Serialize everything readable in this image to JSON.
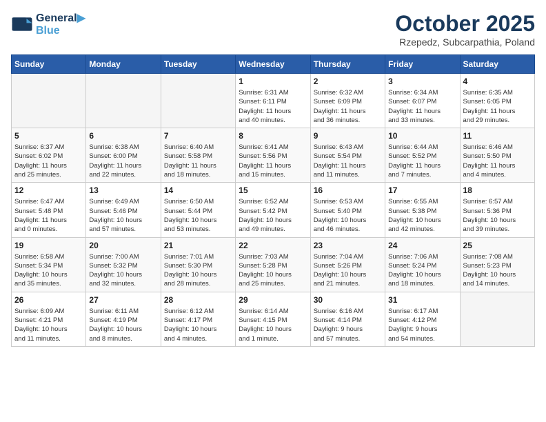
{
  "header": {
    "logo_line1": "General",
    "logo_line2": "Blue",
    "month": "October 2025",
    "location": "Rzepedz, Subcarpathia, Poland"
  },
  "weekdays": [
    "Sunday",
    "Monday",
    "Tuesday",
    "Wednesday",
    "Thursday",
    "Friday",
    "Saturday"
  ],
  "weeks": [
    [
      {
        "day": "",
        "info": ""
      },
      {
        "day": "",
        "info": ""
      },
      {
        "day": "",
        "info": ""
      },
      {
        "day": "1",
        "info": "Sunrise: 6:31 AM\nSunset: 6:11 PM\nDaylight: 11 hours\nand 40 minutes."
      },
      {
        "day": "2",
        "info": "Sunrise: 6:32 AM\nSunset: 6:09 PM\nDaylight: 11 hours\nand 36 minutes."
      },
      {
        "day": "3",
        "info": "Sunrise: 6:34 AM\nSunset: 6:07 PM\nDaylight: 11 hours\nand 33 minutes."
      },
      {
        "day": "4",
        "info": "Sunrise: 6:35 AM\nSunset: 6:05 PM\nDaylight: 11 hours\nand 29 minutes."
      }
    ],
    [
      {
        "day": "5",
        "info": "Sunrise: 6:37 AM\nSunset: 6:02 PM\nDaylight: 11 hours\nand 25 minutes."
      },
      {
        "day": "6",
        "info": "Sunrise: 6:38 AM\nSunset: 6:00 PM\nDaylight: 11 hours\nand 22 minutes."
      },
      {
        "day": "7",
        "info": "Sunrise: 6:40 AM\nSunset: 5:58 PM\nDaylight: 11 hours\nand 18 minutes."
      },
      {
        "day": "8",
        "info": "Sunrise: 6:41 AM\nSunset: 5:56 PM\nDaylight: 11 hours\nand 15 minutes."
      },
      {
        "day": "9",
        "info": "Sunrise: 6:43 AM\nSunset: 5:54 PM\nDaylight: 11 hours\nand 11 minutes."
      },
      {
        "day": "10",
        "info": "Sunrise: 6:44 AM\nSunset: 5:52 PM\nDaylight: 11 hours\nand 7 minutes."
      },
      {
        "day": "11",
        "info": "Sunrise: 6:46 AM\nSunset: 5:50 PM\nDaylight: 11 hours\nand 4 minutes."
      }
    ],
    [
      {
        "day": "12",
        "info": "Sunrise: 6:47 AM\nSunset: 5:48 PM\nDaylight: 11 hours\nand 0 minutes."
      },
      {
        "day": "13",
        "info": "Sunrise: 6:49 AM\nSunset: 5:46 PM\nDaylight: 10 hours\nand 57 minutes."
      },
      {
        "day": "14",
        "info": "Sunrise: 6:50 AM\nSunset: 5:44 PM\nDaylight: 10 hours\nand 53 minutes."
      },
      {
        "day": "15",
        "info": "Sunrise: 6:52 AM\nSunset: 5:42 PM\nDaylight: 10 hours\nand 49 minutes."
      },
      {
        "day": "16",
        "info": "Sunrise: 6:53 AM\nSunset: 5:40 PM\nDaylight: 10 hours\nand 46 minutes."
      },
      {
        "day": "17",
        "info": "Sunrise: 6:55 AM\nSunset: 5:38 PM\nDaylight: 10 hours\nand 42 minutes."
      },
      {
        "day": "18",
        "info": "Sunrise: 6:57 AM\nSunset: 5:36 PM\nDaylight: 10 hours\nand 39 minutes."
      }
    ],
    [
      {
        "day": "19",
        "info": "Sunrise: 6:58 AM\nSunset: 5:34 PM\nDaylight: 10 hours\nand 35 minutes."
      },
      {
        "day": "20",
        "info": "Sunrise: 7:00 AM\nSunset: 5:32 PM\nDaylight: 10 hours\nand 32 minutes."
      },
      {
        "day": "21",
        "info": "Sunrise: 7:01 AM\nSunset: 5:30 PM\nDaylight: 10 hours\nand 28 minutes."
      },
      {
        "day": "22",
        "info": "Sunrise: 7:03 AM\nSunset: 5:28 PM\nDaylight: 10 hours\nand 25 minutes."
      },
      {
        "day": "23",
        "info": "Sunrise: 7:04 AM\nSunset: 5:26 PM\nDaylight: 10 hours\nand 21 minutes."
      },
      {
        "day": "24",
        "info": "Sunrise: 7:06 AM\nSunset: 5:24 PM\nDaylight: 10 hours\nand 18 minutes."
      },
      {
        "day": "25",
        "info": "Sunrise: 7:08 AM\nSunset: 5:23 PM\nDaylight: 10 hours\nand 14 minutes."
      }
    ],
    [
      {
        "day": "26",
        "info": "Sunrise: 6:09 AM\nSunset: 4:21 PM\nDaylight: 10 hours\nand 11 minutes."
      },
      {
        "day": "27",
        "info": "Sunrise: 6:11 AM\nSunset: 4:19 PM\nDaylight: 10 hours\nand 8 minutes."
      },
      {
        "day": "28",
        "info": "Sunrise: 6:12 AM\nSunset: 4:17 PM\nDaylight: 10 hours\nand 4 minutes."
      },
      {
        "day": "29",
        "info": "Sunrise: 6:14 AM\nSunset: 4:15 PM\nDaylight: 10 hours\nand 1 minute."
      },
      {
        "day": "30",
        "info": "Sunrise: 6:16 AM\nSunset: 4:14 PM\nDaylight: 9 hours\nand 57 minutes."
      },
      {
        "day": "31",
        "info": "Sunrise: 6:17 AM\nSunset: 4:12 PM\nDaylight: 9 hours\nand 54 minutes."
      },
      {
        "day": "",
        "info": ""
      }
    ]
  ]
}
